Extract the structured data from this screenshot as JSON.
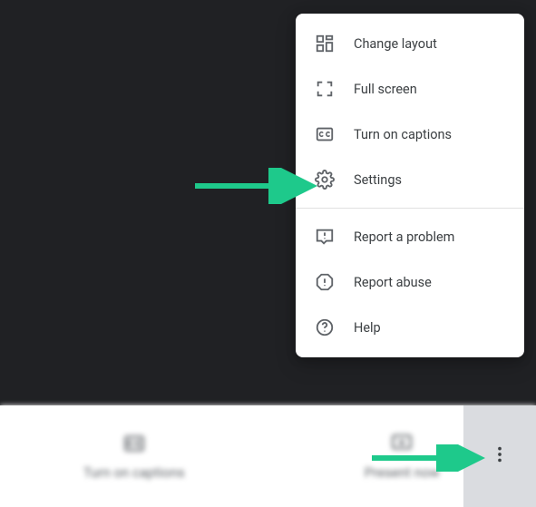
{
  "menu": {
    "items": [
      {
        "label": "Change layout"
      },
      {
        "label": "Full screen"
      },
      {
        "label": "Turn on captions"
      },
      {
        "label": "Settings"
      },
      {
        "label": "Report a problem"
      },
      {
        "label": "Report abuse"
      },
      {
        "label": "Help"
      }
    ]
  },
  "bottom": {
    "captions_label": "Turn on captions",
    "present_label": "Present now"
  },
  "colors": {
    "accent_arrow": "#1ec98b"
  }
}
